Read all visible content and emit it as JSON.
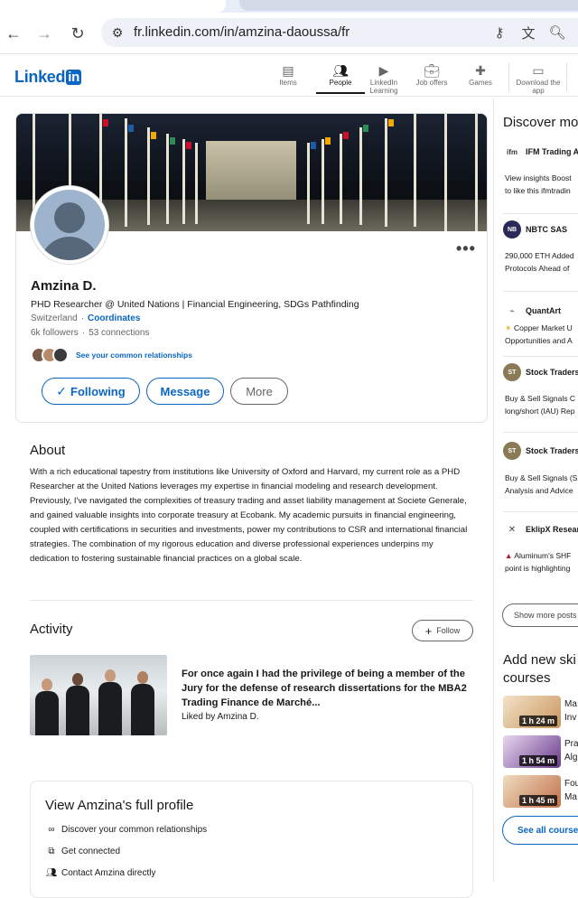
{
  "browser": {
    "url": "fr.linkedin.com/in/amzina-daoussa/fr"
  },
  "header": {
    "logo_text": "Linked",
    "logo_in": "in",
    "nav": [
      {
        "label": "Items",
        "icon": "items-icon"
      },
      {
        "label": "People",
        "icon": "people-icon"
      },
      {
        "label": "LinkedIn Learning",
        "icon": "learning-icon"
      },
      {
        "label": "Job offers",
        "icon": "jobs-icon"
      },
      {
        "label": "Games",
        "icon": "games-icon"
      },
      {
        "label": "Download the app",
        "icon": "download-app-icon"
      }
    ],
    "active_nav": "People"
  },
  "profile": {
    "name": "Amzina D.",
    "headline": "PHD Researcher @ United Nations | Financial Engineering, SDGs Pathfinding",
    "location": "Switzerland",
    "location_sep": "·",
    "coordinates_link": "Coordinates",
    "followers": "6k followers",
    "stats_sep": "·",
    "connections": "53 connections",
    "mutual_text": "See your common relationships",
    "buttons": {
      "following": "Following",
      "message": "Message",
      "more": "More"
    }
  },
  "about": {
    "heading": "About",
    "text": "With a rich educational tapestry from institutions like University of Oxford and Harvard, my current role as a PHD Researcher at the United Nations leverages my expertise in financial modeling and research development. Previously, I've navigated the complexities of treasury trading and asset liability management at Societe Generale, and gained valuable insights into corporate treasury at Ecobank. My academic pursuits in financial engineering, coupled with certifications in securities and investments, power my contributions to CSR and international financial strategies. The combination of my rigorous education and diverse professional experiences underpins my dedication to fostering sustainable financial practices on a global scale."
  },
  "activity": {
    "heading": "Activity",
    "follow_label": "Follow",
    "post_title": "For once again I had the privilege of being a member of the Jury for the defense of research dissertations for the MBA2 Trading Finance de Marché...",
    "post_sub": "Liked by Amzina D."
  },
  "full_profile": {
    "title": "View Amzina's full profile",
    "items": [
      "Discover your common relationships",
      "Get connected",
      "Contact Amzina directly"
    ]
  },
  "sidebar": {
    "title": "Discover mo",
    "posts": [
      {
        "name": "IFM Trading A",
        "logo": "ifm",
        "lines": [
          "View insights Boost",
          "to like this ifmtradin"
        ]
      },
      {
        "name": "NBTC SAS",
        "logo": "NB",
        "lines": [
          "290,000 ETH Added",
          "Protocols Ahead of"
        ]
      },
      {
        "name": "QuantArt",
        "logo": "Q",
        "lines": [
          "Copper Market U",
          "Opportunities and A"
        ]
      },
      {
        "name": "Stock Traders",
        "logo": "ST",
        "lines": [
          "Buy & Sell Signals C",
          "long/short (IAU) Rep"
        ]
      },
      {
        "name": "Stock Traders",
        "logo": "ST",
        "lines": [
          "Buy & Sell Signals (S",
          "Analysis and Advice"
        ]
      },
      {
        "name": "EklipX Researc",
        "logo": "E",
        "lines": [
          "Aluminum's SHF",
          "point is highlighting"
        ]
      }
    ],
    "show_more": "Show more posts",
    "add_skills": "Add new ski courses",
    "add_skills_l1": "Add new ski",
    "add_skills_l2": "courses",
    "courses": [
      {
        "duration": "1 h 24 m",
        "l1": "Ma",
        "l2": "Inv"
      },
      {
        "duration": "1 h 54 m",
        "l1": "Pra",
        "l2": "Alg"
      },
      {
        "duration": "1 h 45 m",
        "l1": "Fou",
        "l2": "Ma"
      }
    ],
    "see_all": "See all courses"
  },
  "colors": {
    "brand": "#0a66c2",
    "text": "#191919",
    "muted": "#666666"
  }
}
